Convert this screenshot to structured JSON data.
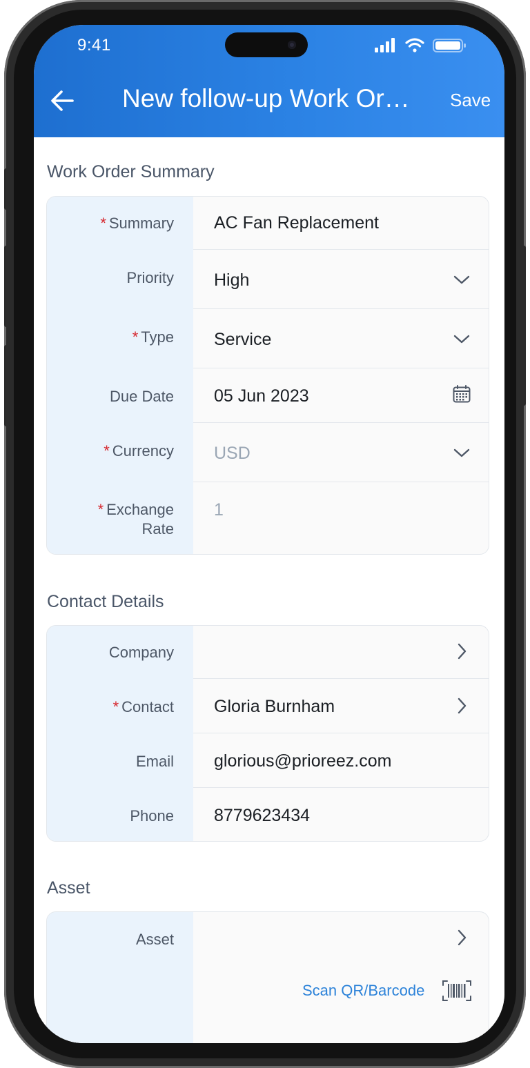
{
  "status_bar": {
    "time": "9:41"
  },
  "appbar": {
    "title": "New follow-up Work Or…",
    "save_label": "Save"
  },
  "sections": {
    "summary": {
      "title": "Work Order Summary",
      "fields": {
        "summary": {
          "label": "Summary",
          "required": "*",
          "value": "AC Fan Replacement"
        },
        "priority": {
          "label": "Priority",
          "value": "High"
        },
        "type": {
          "label": "Type",
          "required": "*",
          "value": "Service"
        },
        "due_date": {
          "label": "Due Date",
          "value": "05 Jun 2023"
        },
        "currency": {
          "label": "Currency",
          "required": "*",
          "value": "USD"
        },
        "exchange_rate": {
          "label_line1": "Exchange",
          "label_line2": "Rate",
          "required": "*",
          "value": "1"
        }
      }
    },
    "contact": {
      "title": "Contact Details",
      "fields": {
        "company": {
          "label": "Company",
          "value": ""
        },
        "contact": {
          "label": "Contact",
          "required": "*",
          "value": "Gloria Burnham"
        },
        "email": {
          "label": "Email",
          "value": "glorious@prioreez.com"
        },
        "phone": {
          "label": "Phone",
          "value": "8779623434"
        }
      }
    },
    "asset": {
      "title": "Asset",
      "fields": {
        "asset": {
          "label": "Asset",
          "value": "",
          "scan_label": "Scan QR/Barcode"
        }
      }
    }
  },
  "colors": {
    "header_start": "#1e6fd0",
    "header_end": "#3a8ff0",
    "label_column": "#eaf3fc",
    "required": "#d6262d",
    "link": "#2d83d9"
  }
}
